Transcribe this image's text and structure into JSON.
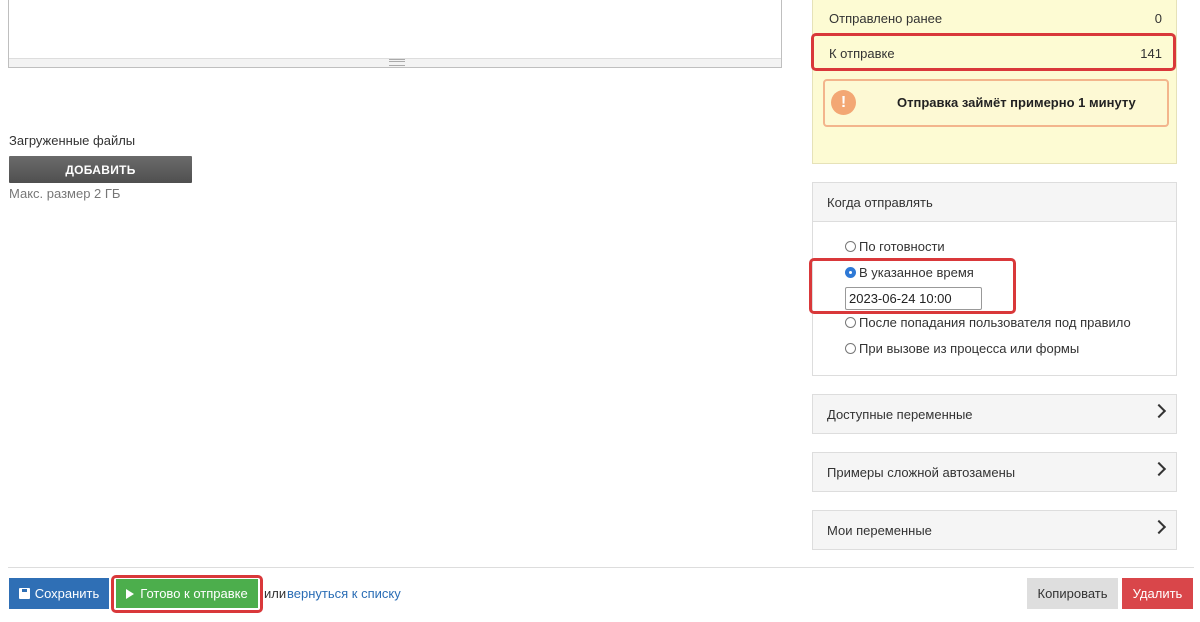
{
  "uploads": {
    "label": "Загруженные файлы",
    "add_button": "ДОБАВИТЬ",
    "max_size": "Макс. размер 2 ГБ"
  },
  "summary": {
    "sent_label": "Отправлено ранее",
    "sent_value": "0",
    "to_send_label": "К отправке",
    "to_send_value": "141",
    "warning_icon": "!",
    "warning_text": "Отправка займёт примерно 1 минуту"
  },
  "schedule": {
    "header": "Когда отправлять",
    "options": [
      "По готовности",
      "В указанное время",
      "После попадания пользователя под правило",
      "При вызове из процесса или формы"
    ],
    "selected_index": 1,
    "datetime_value": "2023-06-24 10:00"
  },
  "collapsibles": [
    "Доступные переменные",
    "Примеры сложной автозамены",
    "Мои переменные"
  ],
  "footer": {
    "save_label": "Сохранить",
    "ready_label": "Готово к отправке",
    "or_text": "или",
    "back_link": "вернуться к списку",
    "copy_label": "Копировать",
    "delete_label": "Удалить"
  },
  "icons": {
    "save": "floppy-disk-icon",
    "ready": "play-icon",
    "warning": "exclamation-icon",
    "chevron": "chevron-right-icon"
  },
  "colors": {
    "highlight": "#d9383a",
    "primary": "#2f6fb5",
    "success": "#4cae4c",
    "danger": "#d9464a",
    "summary_bg": "#fdfbd3"
  }
}
